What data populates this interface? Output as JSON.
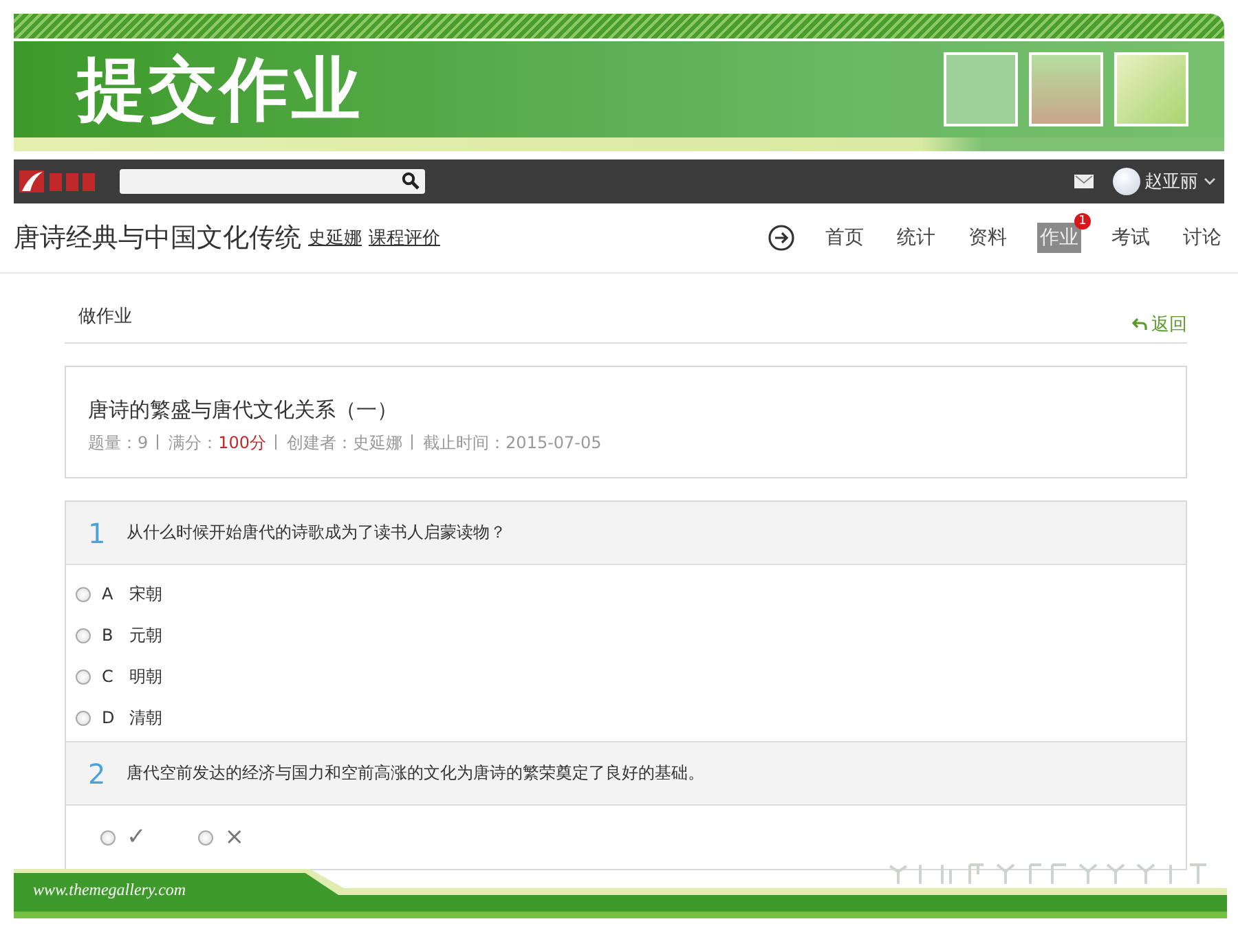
{
  "slide": {
    "title": "提交作业"
  },
  "topbar": {
    "user": "赵亚丽"
  },
  "course": {
    "title": "唐诗经典与中国文化传统",
    "links": [
      "史延娜",
      "课程评价"
    ],
    "nav": [
      {
        "label": "首页",
        "selected": false
      },
      {
        "label": "统计",
        "selected": false
      },
      {
        "label": "资料",
        "selected": false
      },
      {
        "label": "作业",
        "selected": true,
        "badge": "1"
      },
      {
        "label": "考试",
        "selected": false
      },
      {
        "label": "讨论",
        "selected": false
      }
    ]
  },
  "section": {
    "title": "做作业",
    "back": "返回"
  },
  "assignment": {
    "title": "唐诗的繁盛与唐代文化关系（一）",
    "meta": [
      {
        "label": "题量：",
        "value": "9",
        "highlight": false
      },
      {
        "label": "满分：",
        "value": "100分",
        "highlight": true
      },
      {
        "label": "创建者：",
        "value": "史延娜",
        "highlight": false
      },
      {
        "label": "截止时间：",
        "value": "2015-07-05",
        "highlight": false
      }
    ]
  },
  "questions": [
    {
      "number": "1",
      "text": "从什么时候开始唐代的诗歌成为了读书人启蒙读物？",
      "kind": "choice",
      "options": [
        {
          "letter": "A",
          "text": "宋朝",
          "selected": false
        },
        {
          "letter": "B",
          "text": "元朝",
          "selected": false
        },
        {
          "letter": "C",
          "text": "明朝",
          "selected": false
        },
        {
          "letter": "D",
          "text": "清朝",
          "selected": false
        }
      ]
    },
    {
      "number": "2",
      "text": "唐代空前发达的经济与国力和空前高涨的文化为唐诗的繁荣奠定了良好的基础。",
      "kind": "judge",
      "options": [
        {
          "symbol": "✓",
          "selected": false
        },
        {
          "symbol": "×",
          "selected": false
        }
      ]
    }
  ],
  "footer": {
    "url": "www.themegallery.com"
  }
}
